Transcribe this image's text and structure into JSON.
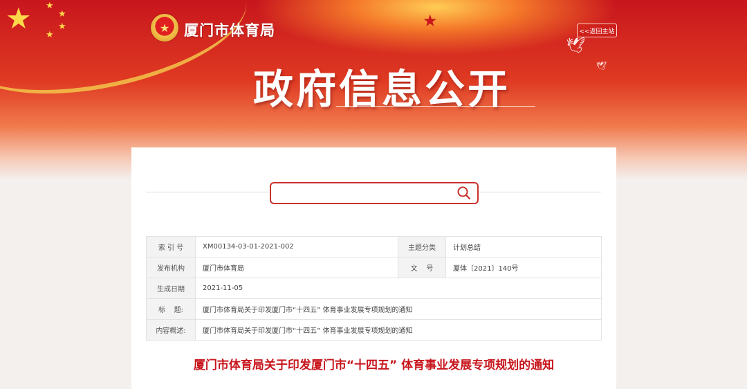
{
  "header": {
    "site_name": "厦门市体育局",
    "back_home_label": "<<返回主站",
    "hero_title": "政府信息公开"
  },
  "search": {
    "value": "",
    "placeholder": ""
  },
  "info": {
    "index_label": "索 引 号",
    "index_value": "XM00134-03-01-2021-002",
    "category_label": "主题分类",
    "category_value": "计划总结",
    "publisher_label": "发布机构",
    "publisher_value": "厦门市体育局",
    "docno_label": "文    号",
    "docno_value": "厦体〔2021〕140号",
    "date_label": "生成日期",
    "date_value": "2021-11-05",
    "title_label": "标    题:",
    "title_value": "厦门市体育局关于印发厦门市“十四五” 体育事业发展专项规划的通知",
    "summary_label": "内容概述:",
    "summary_value": "厦门市体育局关于印发厦门市“十四五” 体育事业发展专项规划的通知"
  },
  "document": {
    "title": "厦门市体育局关于印发厦门市“十四五” 体育事业发展专项规划的通知"
  },
  "colors": {
    "brand_red": "#c8161d",
    "search_border": "#c9302c"
  }
}
